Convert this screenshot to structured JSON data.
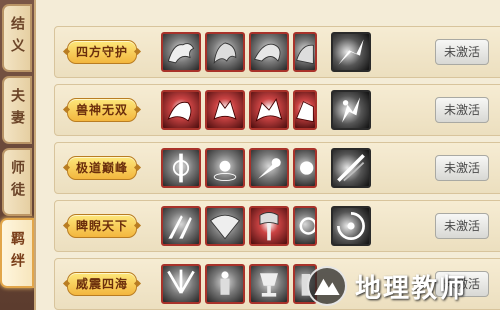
{
  "tabs": [
    {
      "label": "结义",
      "active": false
    },
    {
      "label": "夫妻",
      "active": false
    },
    {
      "label": "师徒",
      "active": false
    },
    {
      "label": "羁绊",
      "active": true
    }
  ],
  "rows": [
    {
      "name": "四方守护",
      "button": "未激活",
      "icons": [
        "dragon",
        "beast",
        "dragon",
        "beast-partial",
        "skill-dash"
      ]
    },
    {
      "name": "兽神无双",
      "button": "未激活",
      "icons": [
        "red-beast",
        "red-wolf",
        "red-wolf",
        "red-partial",
        "skill-strike"
      ]
    },
    {
      "name": "极道巅峰",
      "button": "未激活",
      "icons": [
        "sword-light",
        "orb",
        "comet",
        "burst-partial",
        "skill-slash"
      ]
    },
    {
      "name": "睥睨天下",
      "button": "未激活",
      "icons": [
        "blades",
        "fan",
        "axe-red",
        "ring-partial",
        "skill-spin"
      ]
    },
    {
      "name": "威震四海",
      "button": "未激活",
      "icons": [
        "rays",
        "statue",
        "trophy",
        "tower-partial",
        "skill-blast"
      ]
    }
  ],
  "watermark": {
    "text": "地理教师",
    "logo_icon": "mountain-logo-icon"
  }
}
